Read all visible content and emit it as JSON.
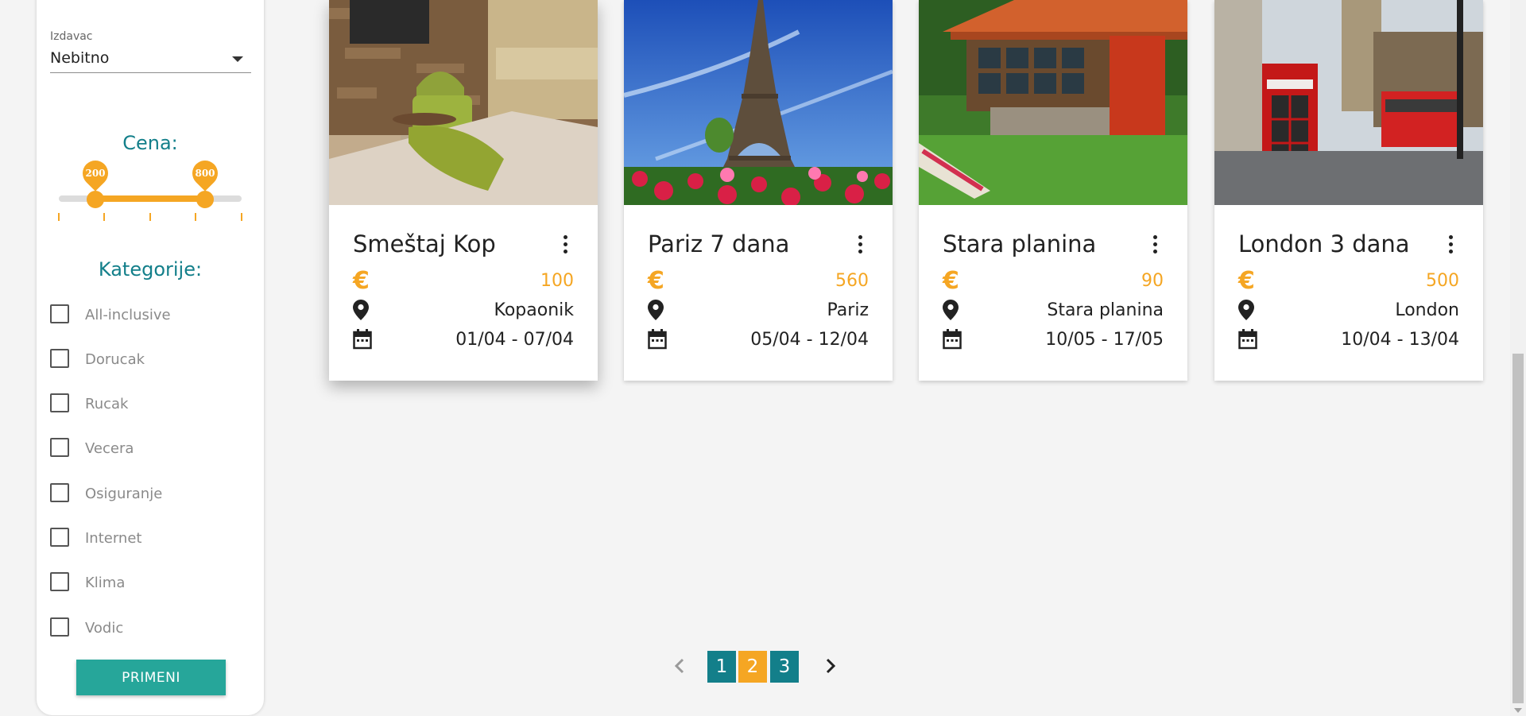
{
  "sidebar": {
    "publisher_label": "Izdavac",
    "publisher_value": "Nebitno",
    "price_title": "Cena:",
    "price_range": {
      "min": 0,
      "max": 1000,
      "low": 200,
      "high": 800,
      "low_label": "200",
      "high_label": "800"
    },
    "categories_title": "Kategorije:",
    "categories": [
      {
        "label": "All-inclusive",
        "checked": false
      },
      {
        "label": "Dorucak",
        "checked": false
      },
      {
        "label": "Rucak",
        "checked": false
      },
      {
        "label": "Vecera",
        "checked": false
      },
      {
        "label": "Osiguranje",
        "checked": false
      },
      {
        "label": "Internet",
        "checked": false
      },
      {
        "label": "Klima",
        "checked": false
      },
      {
        "label": "Vodic",
        "checked": false
      }
    ],
    "apply_label": "PRIMENI"
  },
  "cards": [
    {
      "title": "Smeštaj Kop",
      "currency": "€",
      "price": "100",
      "location": "Kopaonik",
      "dates": "01/04 - 07/04",
      "image": "apartment-interior"
    },
    {
      "title": "Pariz 7 dana",
      "currency": "€",
      "price": "560",
      "location": "Pariz",
      "dates": "05/04 - 12/04",
      "image": "eiffel-tower"
    },
    {
      "title": "Stara planina",
      "currency": "€",
      "price": "90",
      "location": "Stara planina",
      "dates": "10/05 - 17/05",
      "image": "mountain-cottage"
    },
    {
      "title": "London 3 dana",
      "currency": "€",
      "price": "500",
      "location": "London",
      "dates": "10/04 - 13/04",
      "image": "london-phone-booth"
    }
  ],
  "pagination": {
    "pages": [
      "1",
      "2",
      "3"
    ],
    "current": "2"
  },
  "colors": {
    "accent_orange": "#f5a623",
    "teal_dark": "#137f8a",
    "teal_button": "#26a69a"
  }
}
